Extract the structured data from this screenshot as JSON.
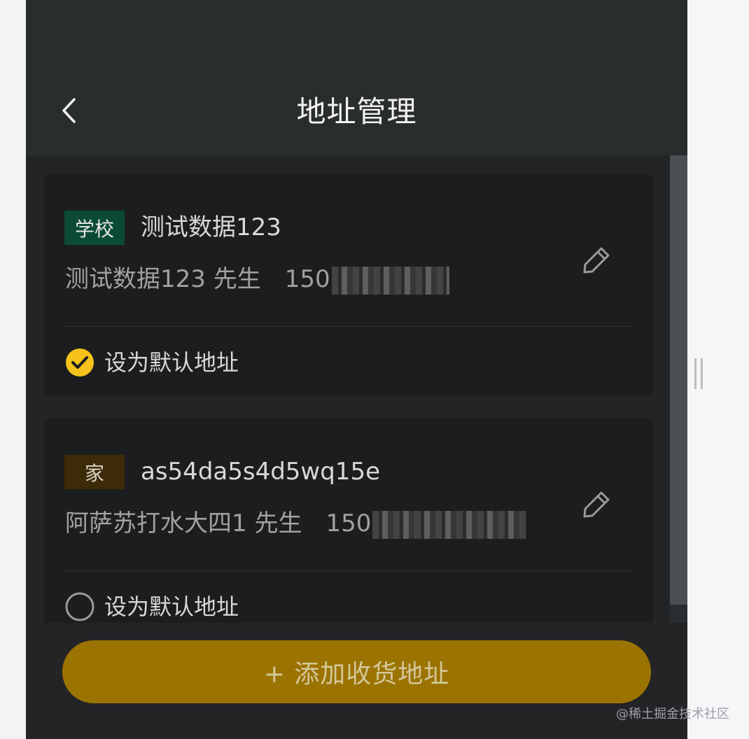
{
  "header": {
    "title": "地址管理",
    "back_icon": "chevron-left-icon"
  },
  "addresses": [
    {
      "tag": "学校",
      "tag_color": "#0b4a37",
      "name": "测试数据123",
      "contact_name": "测试数据123 先生",
      "phone_visible": "150",
      "phone_masked": true,
      "edit_icon": "pencil-icon",
      "default_label": "设为默认地址",
      "is_default": true
    },
    {
      "tag": "家",
      "tag_color": "#3c2a08",
      "name": "as54da5s4d5wq15e",
      "contact_name": "阿萨苏打水大四1 先生",
      "phone_visible": "150",
      "phone_masked": true,
      "edit_icon": "pencil-icon",
      "default_label": "设为默认地址",
      "is_default": false
    }
  ],
  "footer": {
    "add_button_label": "+ 添加收货地址",
    "accent_color": "#9b7300"
  },
  "watermark": "@稀土掘金技术社区",
  "colors": {
    "background": "#232426",
    "navbar": "#2a2d2e",
    "card": "#1c1d1e",
    "check_yellow": "#f5c21b"
  }
}
